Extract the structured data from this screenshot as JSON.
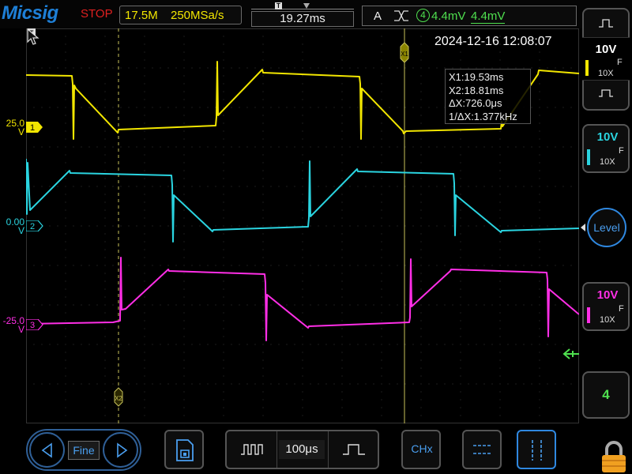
{
  "header": {
    "brand": "Micsig",
    "run_state": "STOP",
    "memory_depth": "17.5M",
    "sample_rate": "250MSa/s",
    "h_position": "19.27ms",
    "trigger": {
      "mode": "A",
      "edge_icon": "rising-falling-edge-icon",
      "source": "4",
      "level": "4.4mV",
      "level_secondary": "4.4mV"
    }
  },
  "screen": {
    "datetime": "2024-12-16 12:08:07",
    "cursor_x1_tag": "X1",
    "cursor_x2_tag": "X2",
    "readout": {
      "x1": "X1:19.53ms",
      "x2": "X2:18.81ms",
      "dx": "ΔX:726.0μs",
      "inv_dx": "1/ΔX:1.377kHz"
    }
  },
  "channels": [
    {
      "id": "1",
      "level_label": "25.0",
      "unit": "V",
      "color": "#f2e600"
    },
    {
      "id": "2",
      "level_label": "0.00",
      "unit": "V",
      "color": "#2ad4e0"
    },
    {
      "id": "3",
      "level_label": "-25.0",
      "unit": "V",
      "color": "#ff2ee6"
    }
  ],
  "right_panel": {
    "ch1": {
      "scale": "10V",
      "coupling_icon": "F",
      "probe": "10X",
      "color": "#f2e600"
    },
    "ch2": {
      "scale": "10V",
      "coupling_icon": "F",
      "probe": "10X",
      "color": "#2ad4e0"
    },
    "ch3": {
      "scale": "10V",
      "coupling_icon": "F",
      "probe": "10X",
      "color": "#ff2ee6"
    },
    "level_button": "Level",
    "channel_count": "4"
  },
  "bottom_bar": {
    "fine_label": "Fine",
    "timebase": "100μs",
    "chx_label": "CHx"
  },
  "colors": {
    "accent_blue": "#2f88e0",
    "trigger_green": "#4fe04f",
    "cursor_yellow": "#c7c25a"
  }
}
